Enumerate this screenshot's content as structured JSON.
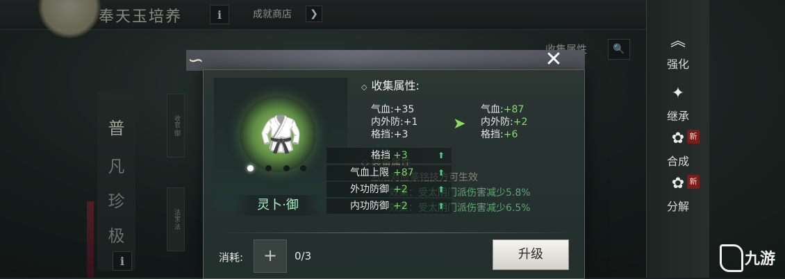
{
  "background": {
    "title": "奉天玉培养",
    "info_icon": "i",
    "shop_link": "成就商店",
    "shop_arrow": "❯",
    "collect_label": "收集属性",
    "search_icon": "🔍",
    "left_tabs": [
      "普",
      "凡",
      "珍",
      "极"
    ],
    "strips": [
      "收官·御",
      "法宝·法"
    ],
    "right_menu": [
      {
        "label": "强化",
        "icon": "︽",
        "badge": ""
      },
      {
        "label": "继承",
        "icon": "✦",
        "badge": ""
      },
      {
        "label": "合成",
        "icon": "✿",
        "badge": "新"
      },
      {
        "label": "分解",
        "icon": "✿",
        "badge": "新"
      }
    ],
    "watermark": "九游"
  },
  "modal": {
    "close_icon": "✕",
    "item_name": "灵卜·御",
    "page_dots": 4,
    "active_dot": 0,
    "collect_title": "收集属性:",
    "current_stats": [
      {
        "label": "气血:",
        "value": "+35"
      },
      {
        "label": "内外防:",
        "value": "+1"
      },
      {
        "label": "格挡:",
        "value": "+3"
      }
    ],
    "next_stats": [
      {
        "label": "气血:",
        "value": "+87"
      },
      {
        "label": "内外防:",
        "value": "+2"
      },
      {
        "label": "格挡:",
        "value": "+6"
      }
    ],
    "arrow_icon": "➤",
    "overlay_rows": [
      {
        "label": "格挡",
        "value": "+3"
      },
      {
        "label": "气血上限",
        "value": "+87"
      },
      {
        "label": "外功防御",
        "value": "+2"
      },
      {
        "label": "内功防御",
        "value": "+2"
      }
    ],
    "ghost_section": "装备属性",
    "ghost_line1": "激活对应篆铭技方可生效",
    "ghost_line2": "效果：受太阴门派伤害减少5.8%",
    "ghost_line3": "效果：受太阴门派伤害减少6.5%",
    "cost_label": "消耗:",
    "cost_slot_icon": "+",
    "cost_count": "0/3",
    "upgrade_button": "升级"
  }
}
